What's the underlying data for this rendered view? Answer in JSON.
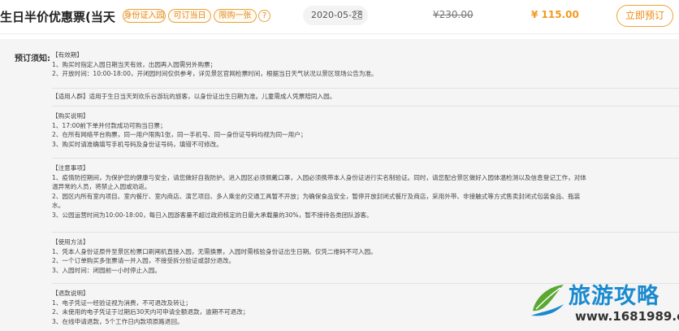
{
  "product": {
    "title": "生日半价优惠票(当天可...",
    "tags": [
      "身份证入园",
      "可订当日",
      "限购一张"
    ],
    "help": "?",
    "date": "2020-05-28",
    "original_price": "¥230.00",
    "sale_price": "¥ 115.00",
    "book_label": "立即预订"
  },
  "notice": {
    "label": "预订须知:",
    "sections": [
      {
        "lines": [
          "【有效期】",
          "1、购买时指定入园日期当天有效，出园再入园需另外购票；",
          "2、开放时间：10:00-18:00，开闭园时间仅供参考，详见景区官网检票时间，根据当日天气状况以景区现场公告为准。"
        ]
      },
      {
        "lines": [
          "【适用人群】适用于生日当天到欢乐谷游玩的旅客，以身份证出生日期为准。儿童需成人凭票陪同入园。"
        ]
      },
      {
        "lines": [
          "【购买说明】",
          "1、17:00前下单并付款成功可购当日票；",
          "2、在所有网络平台购票，同一用户限购1张，同一手机号、同一身份证号码均视为同一用户；",
          "3、购买时请准确填写手机号码及身份证号码，填错不可修改。"
        ]
      },
      {
        "lines": [
          "【注意事项】",
          "1、疫情防控期间，为保护您的健康与安全，请您做好自我防护。进入园区必须佩戴口罩，入园必须携带本人身份证进行实名制验证。同时，请您配合景区做好入园体温检测以及信息登记工作，对体",
          "温异常的人员，将禁止入园或劝返。",
          "2、园区内所有室内项目、室内餐厅、室内商店、演艺项目、多人乘坐的交通工具暂不开放；为确保食品安全，暂停开放封闭式餐厅及商店，采用外带、非接触式等方式售卖封闭式包装食品、瓶装",
          "水。",
          "3、公园运营时间为10:00-18:00，每日入园游客量不超过政府核定的日最大承载量的30%，暂不接待各类团队游客。"
        ]
      },
      {
        "lines": [
          "【使用方法】",
          "1、凭本人身份证原件至景区检票口刷闸机直接入园，无需换票，入园时需核验身份证出生日期。仅凭二维码不可入园。",
          "2、一个订单购买多张票请一并入园，不接受拆分验证或部分退改。",
          "3、入园时间：闭园前一小时停止入园。"
        ]
      },
      {
        "lines": [
          "【退款说明】",
          "1、电子凭证一经验证视为消费，不可退改及转让；",
          "2、未使用的电子凭证于过期后30天内可申请全额退款，逾期不可退改；",
          "3、在线申请退款，5个工作日内款项原路退回。"
        ]
      }
    ]
  },
  "watermark": {
    "title": "旅游攻略",
    "url": "www.1681989.cn",
    "colors": {
      "title": "#1a8ad0",
      "leaf_green": "#5aa832",
      "leaf_blue": "#1a8ad0"
    }
  },
  "colors": {
    "accent": "#f08a0e",
    "price": "#f39a1e",
    "background": "#f5f5f5"
  }
}
